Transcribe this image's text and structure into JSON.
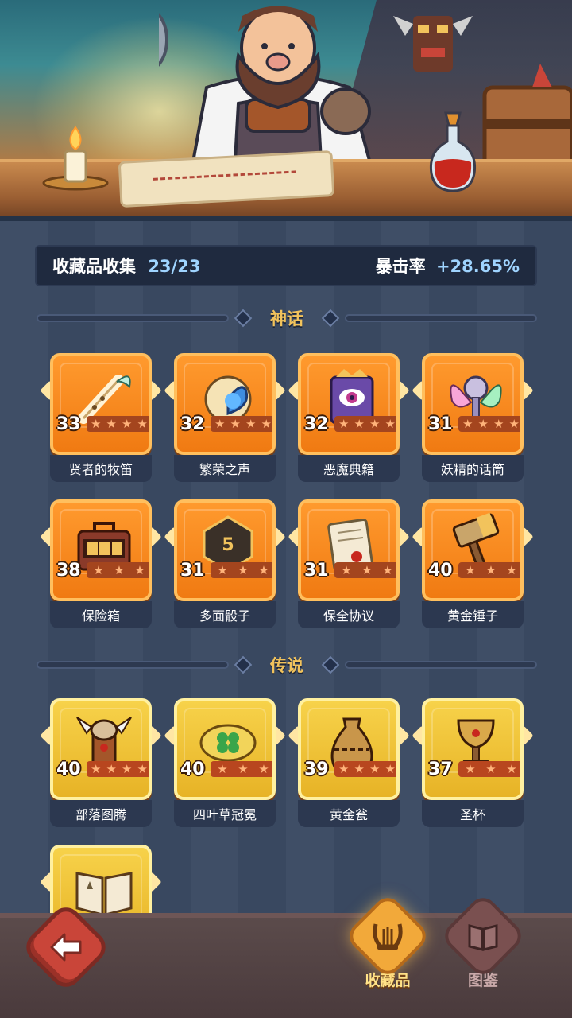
{
  "stats": {
    "collection_label": "收藏品收集",
    "collection_value": "23/23",
    "crit_label": "暴击率",
    "crit_value": "+28.65%"
  },
  "sections": {
    "mythic_title": "神话",
    "legend_title": "传说"
  },
  "mythic_items": [
    {
      "name": "贤者的牧笛",
      "level": "33",
      "stars": 4,
      "icon": "flute-icon"
    },
    {
      "name": "繁荣之声",
      "level": "32",
      "stars": 4,
      "icon": "conch-icon"
    },
    {
      "name": "恶魔典籍",
      "level": "32",
      "stars": 4,
      "icon": "demon-book-icon"
    },
    {
      "name": "妖精的话筒",
      "level": "31",
      "stars": 4,
      "icon": "fairy-mic-icon"
    },
    {
      "name": "保险箱",
      "level": "38",
      "stars": 3,
      "icon": "safe-box-icon"
    },
    {
      "name": "多面骰子",
      "level": "31",
      "stars": 3,
      "icon": "dice-icon"
    },
    {
      "name": "保全协议",
      "level": "31",
      "stars": 3,
      "icon": "contract-icon"
    },
    {
      "name": "黄金锤子",
      "level": "40",
      "stars": 3,
      "icon": "hammer-icon"
    }
  ],
  "legend_items": [
    {
      "name": "部落图腾",
      "level": "40",
      "stars": 4,
      "icon": "totem-icon"
    },
    {
      "name": "四叶草冠冕",
      "level": "40",
      "stars": 3,
      "icon": "clover-crown-icon"
    },
    {
      "name": "黄金瓮",
      "level": "39",
      "stars": 4,
      "icon": "golden-urn-icon"
    },
    {
      "name": "圣杯",
      "level": "37",
      "stars": 3,
      "icon": "grail-icon"
    },
    {
      "name": "",
      "level": "",
      "stars": 0,
      "icon": "open-book-icon"
    }
  ],
  "nav": {
    "collection_label": "收藏品",
    "codex_label": "图鉴"
  },
  "colors": {
    "mythic": "#f07a12",
    "legend": "#e7b326",
    "accent_title": "#f2c35c",
    "crit_value": "#9fd4ff"
  }
}
